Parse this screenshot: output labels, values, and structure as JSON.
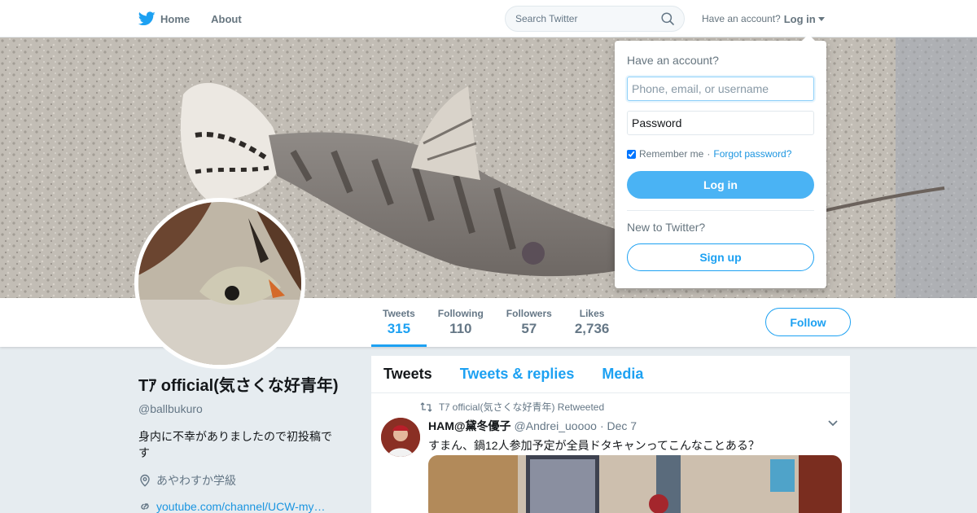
{
  "nav": {
    "home_label": "Home",
    "about_label": "About",
    "search_placeholder": "Search Twitter",
    "have_account_text": "Have an account?",
    "login_label": "Log in"
  },
  "profile": {
    "name": "Tｱ official(気さくな好青年)",
    "handle": "@ballbukuro",
    "bio": "身内に不幸がありましたので初投稿です",
    "location": "あやわすか学級",
    "url": "youtube.com/channel/UCW-my…"
  },
  "stats": [
    {
      "label": "Tweets",
      "value": "315"
    },
    {
      "label": "Following",
      "value": "110"
    },
    {
      "label": "Followers",
      "value": "57"
    },
    {
      "label": "Likes",
      "value": "2,736"
    }
  ],
  "follow_label": "Follow",
  "timeline": {
    "tabs": [
      "Tweets",
      "Tweets & replies",
      "Media"
    ],
    "tweet": {
      "retweet_text": "Tｱ official(気さくな好青年) Retweeted",
      "author_name": "HAM@黛冬優子",
      "author_handle": "@Andrei_uoooo",
      "date": "· Dec 7",
      "text": "すまん、鍋12人参加予定が全員ドタキャンってこんなことある？"
    }
  },
  "login_dropdown": {
    "title": "Have an account?",
    "username_placeholder": "Phone, email, or username",
    "password_placeholder": "Password",
    "remember_label": "Remember me",
    "separator": "·",
    "forgot_label": "Forgot password?",
    "login_button": "Log in",
    "new_text": "New to Twitter?",
    "signup_button": "Sign up"
  },
  "colors": {
    "accent": "#1da1f2",
    "login_button_bg": "#4ab3f4",
    "page_bg": "#e6ecf0"
  }
}
